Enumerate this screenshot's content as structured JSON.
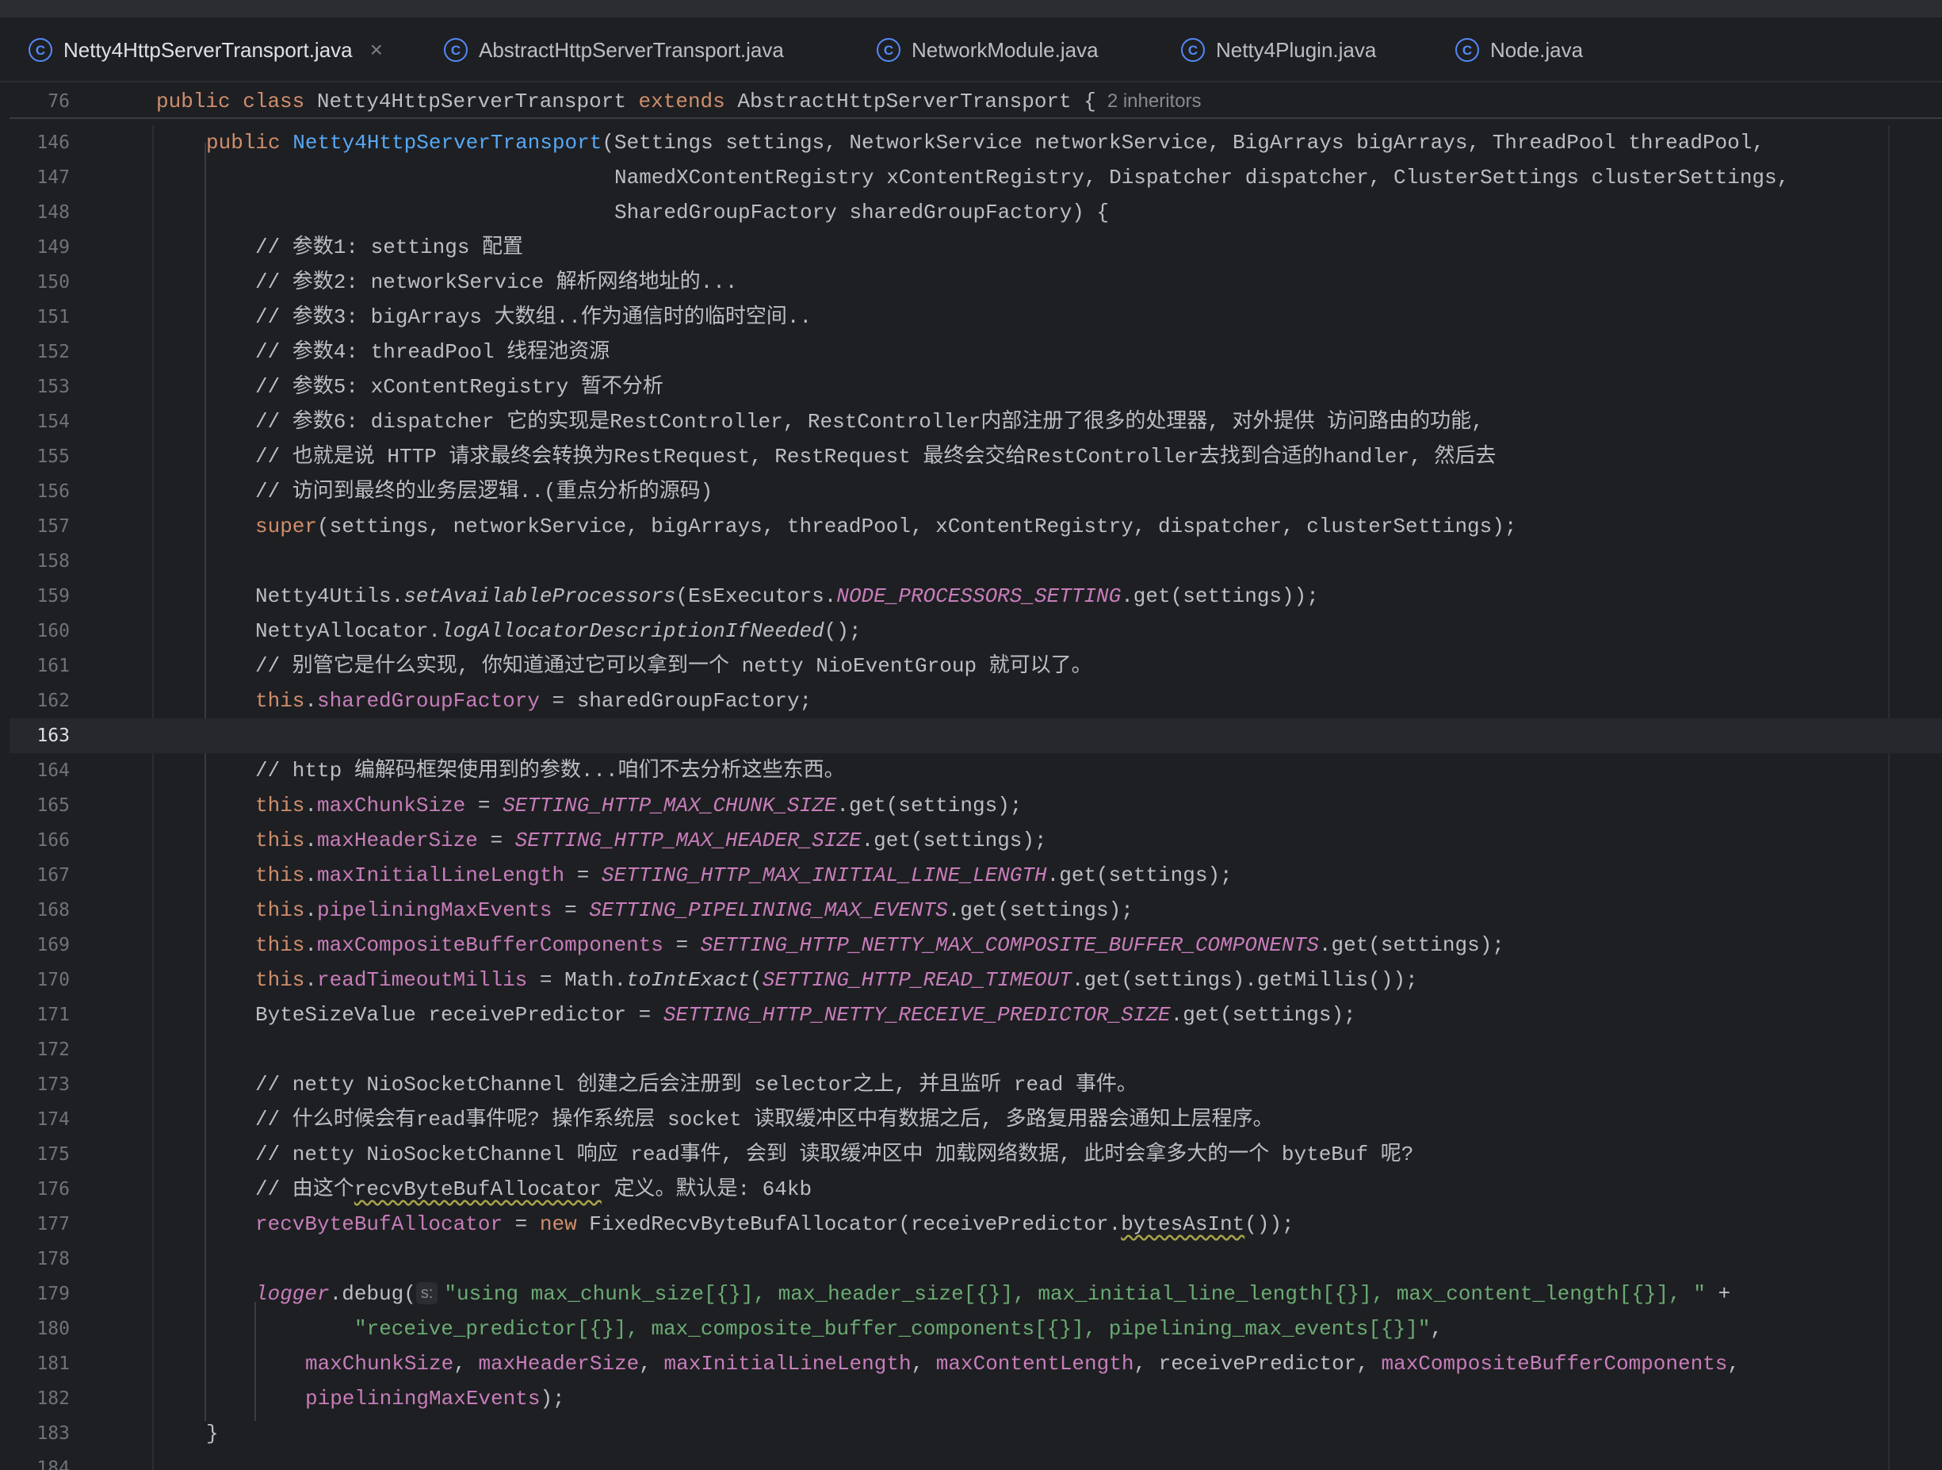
{
  "tabs": [
    {
      "label": "Netty4HttpServerTransport.java",
      "active": true,
      "icon": "class-icon"
    },
    {
      "label": "AbstractHttpServerTransport.java",
      "active": false,
      "icon": "class-icon"
    },
    {
      "label": "NetworkModule.java",
      "active": false,
      "icon": "class-icon"
    },
    {
      "label": "Netty4Plugin.java",
      "active": false,
      "icon": "class-icon"
    },
    {
      "label": "Node.java",
      "active": false,
      "icon": "class-icon"
    }
  ],
  "sticky": {
    "line": "76",
    "kw_public": "public",
    "kw_class": "class",
    "class_name": " Netty4HttpServerTransport ",
    "kw_extends": "extends",
    "parent": " AbstractHttpServerTransport {",
    "hint": "2 inheritors"
  },
  "lines": {
    "l146": {
      "num": "146",
      "a": "public",
      "b": " ",
      "c": "Netty4HttpServerTransport",
      "d": "(Settings settings, NetworkService networkService, BigArrays bigArrays, ThreadPool threadPool,"
    },
    "l147": {
      "num": "147",
      "text": "NamedXContentRegistry xContentRegistry, Dispatcher dispatcher, ClusterSettings clusterSettings,"
    },
    "l148": {
      "num": "148",
      "text": "SharedGroupFactory sharedGroupFactory) {"
    },
    "l149": {
      "num": "149",
      "text": "// 参数1: settings 配置"
    },
    "l150": {
      "num": "150",
      "text": "// 参数2: networkService 解析网络地址的..."
    },
    "l151": {
      "num": "151",
      "text": "// 参数3: bigArrays 大数组..作为通信时的临时空间.."
    },
    "l152": {
      "num": "152",
      "text": "// 参数4: threadPool 线程池资源"
    },
    "l153": {
      "num": "153",
      "text": "// 参数5: xContentRegistry 暂不分析"
    },
    "l154": {
      "num": "154",
      "text": "// 参数6: dispatcher 它的实现是RestController, RestController内部注册了很多的处理器, 对外提供 访问路由的功能,"
    },
    "l155": {
      "num": "155",
      "text": "// 也就是说 HTTP 请求最终会转换为RestRequest, RestRequest 最终会交给RestController去找到合适的handler, 然后去"
    },
    "l156": {
      "num": "156",
      "text": "// 访问到最终的业务层逻辑..(重点分析的源码)"
    },
    "l157": {
      "num": "157",
      "a": "super",
      "b": "(settings, networkService, bigArrays, threadPool, xContentRegistry, dispatcher, clusterSettings);"
    },
    "l158": {
      "num": "158"
    },
    "l159": {
      "num": "159",
      "a": "Netty4Utils.",
      "b": "setAvailableProcessors",
      "c": "(EsExecutors.",
      "d": "NODE_PROCESSORS_SETTING",
      "e": ".get(settings));"
    },
    "l160": {
      "num": "160",
      "a": "NettyAllocator.",
      "b": "logAllocatorDescriptionIfNeeded",
      "c": "();"
    },
    "l161": {
      "num": "161",
      "text": "// 别管它是什么实现, 你知道通过它可以拿到一个 netty NioEventGroup 就可以了。"
    },
    "l162": {
      "num": "162",
      "a": "this",
      "b": ".",
      "c": "sharedGroupFactory",
      "d": " = sharedGroupFactory;"
    },
    "l163": {
      "num": "163"
    },
    "l164": {
      "num": "164",
      "text": "// http 编解码框架使用到的参数...咱们不去分析这些东西。"
    },
    "l165": {
      "num": "165",
      "a": "this",
      "b": ".",
      "c": "maxChunkSize",
      "d": " = ",
      "e": "SETTING_HTTP_MAX_CHUNK_SIZE",
      "f": ".get(settings);"
    },
    "l166": {
      "num": "166",
      "a": "this",
      "b": ".",
      "c": "maxHeaderSize",
      "d": " = ",
      "e": "SETTING_HTTP_MAX_HEADER_SIZE",
      "f": ".get(settings);"
    },
    "l167": {
      "num": "167",
      "a": "this",
      "b": ".",
      "c": "maxInitialLineLength",
      "d": " = ",
      "e": "SETTING_HTTP_MAX_INITIAL_LINE_LENGTH",
      "f": ".get(settings);"
    },
    "l168": {
      "num": "168",
      "a": "this",
      "b": ".",
      "c": "pipeliningMaxEvents",
      "d": " = ",
      "e": "SETTING_PIPELINING_MAX_EVENTS",
      "f": ".get(settings);"
    },
    "l169": {
      "num": "169",
      "a": "this",
      "b": ".",
      "c": "maxCompositeBufferComponents",
      "d": " = ",
      "e": "SETTING_HTTP_NETTY_MAX_COMPOSITE_BUFFER_COMPONENTS",
      "f": ".get(settings);"
    },
    "l170": {
      "num": "170",
      "a": "this",
      "b": ".",
      "c": "readTimeoutMillis",
      "d": " = Math.",
      "e": "toIntExact",
      "f": "(",
      "g": "SETTING_HTTP_READ_TIMEOUT",
      "h": ".get(settings).getMillis());"
    },
    "l171": {
      "num": "171",
      "a": "ByteSizeValue receivePredictor = ",
      "b": "SETTING_HTTP_NETTY_RECEIVE_PREDICTOR_SIZE",
      "c": ".get(settings);"
    },
    "l172": {
      "num": "172"
    },
    "l173": {
      "num": "173",
      "text": "// netty NioSocketChannel 创建之后会注册到 selector之上, 并且监听 read 事件。"
    },
    "l174": {
      "num": "174",
      "text": "// 什么时候会有read事件呢? 操作系统层 socket 读取缓冲区中有数据之后, 多路复用器会通知上层程序。"
    },
    "l175": {
      "num": "175",
      "text": "// netty NioSocketChannel 响应 read事件, 会到 读取缓冲区中 加载网络数据, 此时会拿多大的一个 byteBuf 呢?"
    },
    "l176": {
      "num": "176",
      "a": "// 由这个",
      "b": "recvByteBufAllocator",
      "c": " 定义。默认是: 64kb"
    },
    "l177": {
      "num": "177",
      "a": "recvByteBufAllocator",
      "b": " = ",
      "c": "new",
      "d": " FixedRecvByteBufAllocator(receivePredictor.",
      "e": "bytesAsInt",
      "f": "());"
    },
    "l178": {
      "num": "178"
    },
    "l179": {
      "num": "179",
      "a": "logger",
      "b": ".debug(",
      "hint": "s:",
      "c": "\"using max_chunk_size[{}], max_header_size[{}], max_initial_line_length[{}], max_content_length[{}], \"",
      "d": " +"
    },
    "l180": {
      "num": "180",
      "a": "\"receive_predictor[{}], max_composite_buffer_components[{}], pipelining_max_events[{}]\"",
      "b": ","
    },
    "l181": {
      "num": "181",
      "a": "maxChunkSize",
      "b": ", ",
      "c": "maxHeaderSize",
      "d": ", ",
      "e": "maxInitialLineLength",
      "f": ", ",
      "g": "maxContentLength",
      "h": ", receivePredictor, ",
      "i": "maxCompositeBufferComponents",
      "j": ","
    },
    "l182": {
      "num": "182",
      "a": "pipeliningMaxEvents",
      "b": ");"
    },
    "l183": {
      "num": "183",
      "text": "}"
    },
    "l184": {
      "num": "184"
    }
  },
  "colors": {
    "keyword": "#cf8e6d",
    "method": "#56a8f5",
    "comment": "#7a7e85",
    "field": "#c77dbb",
    "string": "#6aab73",
    "accent": "#3574f0"
  }
}
